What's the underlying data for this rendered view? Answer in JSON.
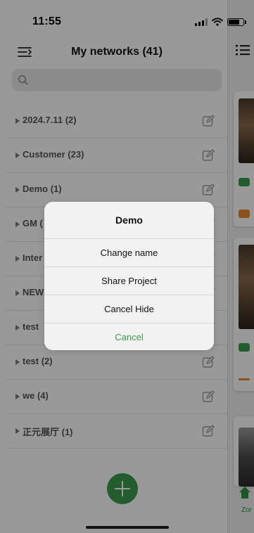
{
  "status": {
    "time": "11:55"
  },
  "header": {
    "title": "My networks (41)"
  },
  "search": {
    "placeholder": ""
  },
  "networks": [
    {
      "label": "2024.7.11 (2)"
    },
    {
      "label": "Customer (23)"
    },
    {
      "label": "Demo (1)"
    },
    {
      "label": "GM ("
    },
    {
      "label": "Inter"
    },
    {
      "label": "NEW"
    },
    {
      "label": "test"
    },
    {
      "label": "test (2)"
    },
    {
      "label": "we (4)"
    },
    {
      "label": "正元展厅 (1)"
    }
  ],
  "dialog": {
    "title": "Demo",
    "actions": [
      "Change name",
      "Share Project",
      "Cancel Hide",
      "Cancel"
    ]
  },
  "right_panel": {
    "home_tab_label": "Zor"
  },
  "colors": {
    "accent": "#3c9b4c",
    "orange": "#e58a2e",
    "overlay": "rgba(0,0,0,0.40)"
  },
  "icons": [
    "menu-icon",
    "search-icon",
    "edit-icon",
    "add-icon",
    "list-view-icon",
    "home-icon"
  ]
}
